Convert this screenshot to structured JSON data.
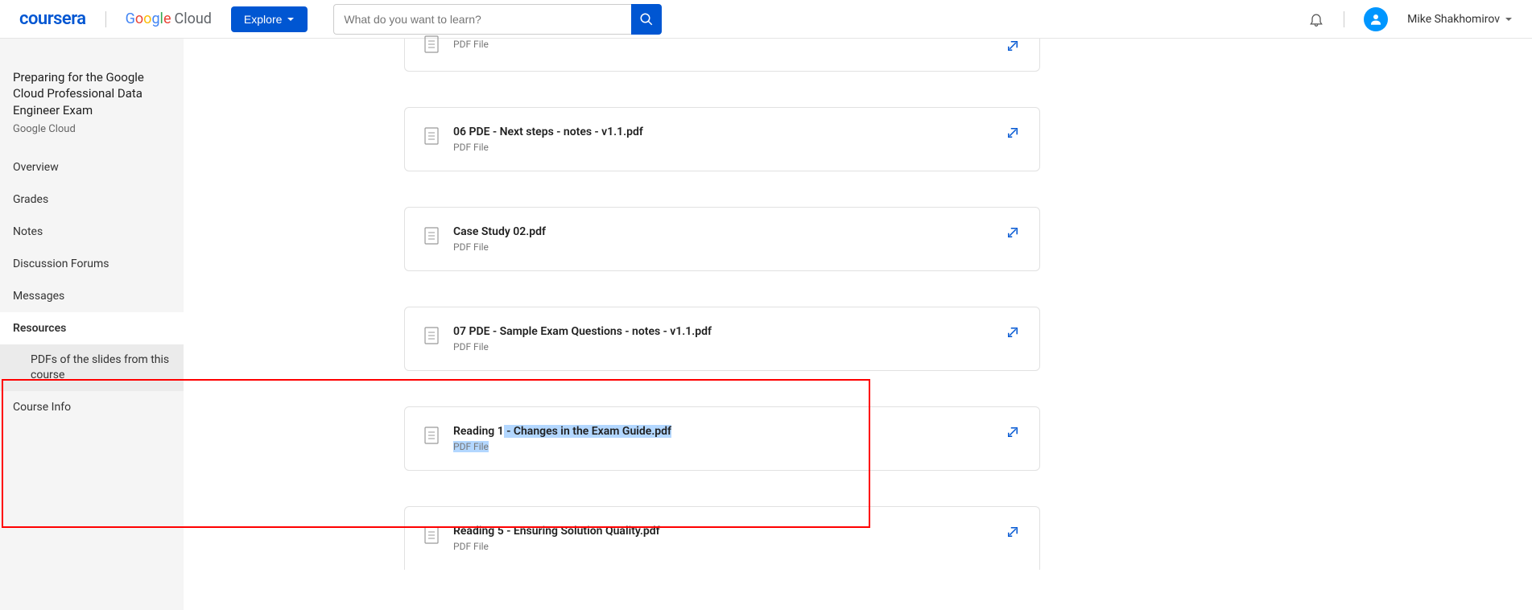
{
  "header": {
    "logo_text": "coursera",
    "partner_logo": {
      "brand": "Google",
      "suffix": "Cloud"
    },
    "explore_label": "Explore",
    "search_placeholder": "What do you want to learn?",
    "user_name": "Mike Shakhomirov"
  },
  "sidebar": {
    "course_title": "Preparing for the Google Cloud Professional Data Engineer Exam",
    "course_subtitle": "Google Cloud",
    "items": [
      {
        "label": "Overview"
      },
      {
        "label": "Grades"
      },
      {
        "label": "Notes"
      },
      {
        "label": "Discussion Forums"
      },
      {
        "label": "Messages"
      },
      {
        "label": "Resources",
        "active": true,
        "sub": [
          {
            "label": "PDFs of the slides from this course"
          }
        ]
      },
      {
        "label": "Course Info"
      }
    ]
  },
  "files": [
    {
      "name": "",
      "type": "PDF File",
      "partial_top": true
    },
    {
      "name": "06 PDE - Next steps - notes - v1.1.pdf",
      "type": "PDF File"
    },
    {
      "name": "Case Study 02.pdf",
      "type": "PDF File"
    },
    {
      "name": "07 PDE - Sample Exam Questions - notes - v1.1.pdf",
      "type": "PDF File"
    },
    {
      "name_pre": "Reading 1",
      "name_hl": " - Changes in the Exam Guide.pdf",
      "type": "PDF File",
      "highlight": true
    },
    {
      "name": "Reading 5 - Ensuring Solution Quality.pdf",
      "type": "PDF File",
      "partial_bottom": true
    }
  ]
}
